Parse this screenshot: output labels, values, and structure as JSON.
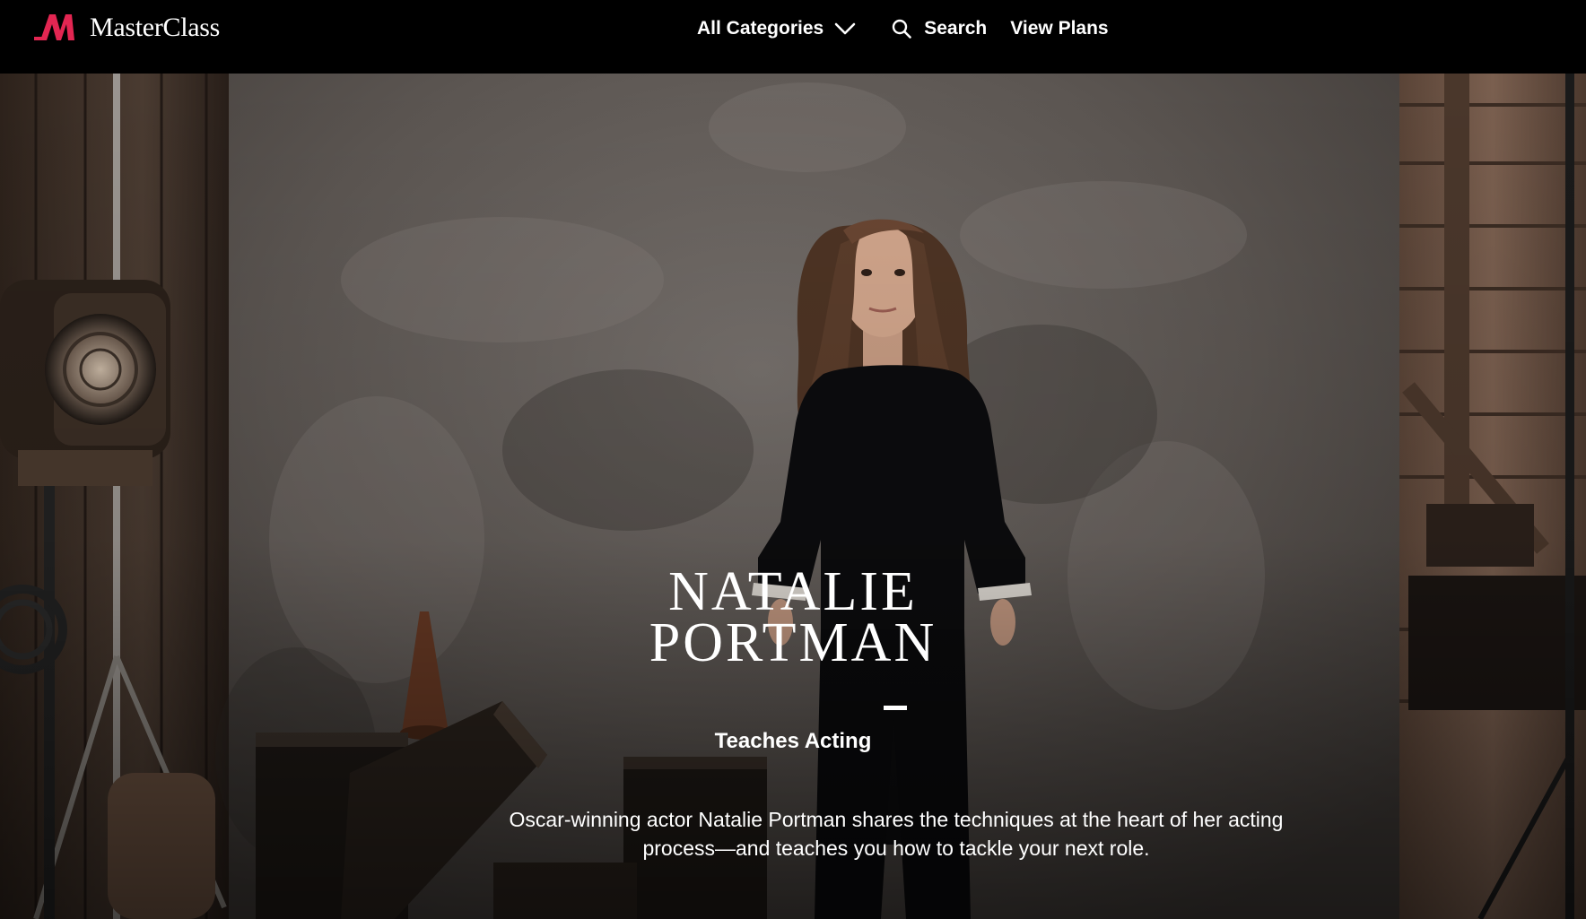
{
  "nav": {
    "logo_text": "MasterClass",
    "categories_label": "All Categories",
    "search_label": "Search",
    "plans_label": "View Plans",
    "icons": {
      "logo": "masterclass-logo-icon",
      "categories_toggle": "chevron-down-icon",
      "search": "search-icon"
    }
  },
  "hero": {
    "name_line1": "Natalie",
    "name_line2": "Portman",
    "teaches": "Teaches Acting",
    "description": "Oscar-winning actor Natalie Portman shares the techniques at the heart of her acting process—and teaches you how to tackle your next role.",
    "image": "instructor-photo-natalie-portman"
  },
  "colors": {
    "nav_background": "#000000",
    "brand_red": "#e32652",
    "text": "#ffffff"
  }
}
